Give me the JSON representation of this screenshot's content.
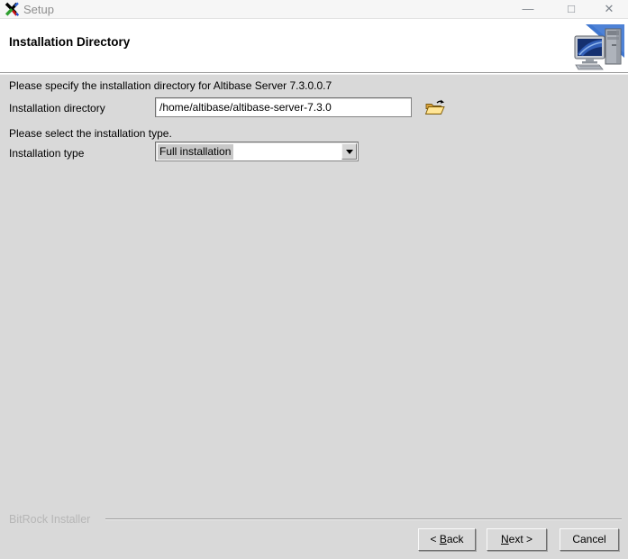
{
  "titlebar": {
    "title": "Setup",
    "minimize_glyph": "—",
    "maximize_glyph": "□",
    "close_glyph": "✕"
  },
  "header": {
    "title": "Installation Directory"
  },
  "form": {
    "directory_prompt": "Please specify the installation directory for Altibase Server 7.3.0.0.7",
    "directory_label": "Installation directory",
    "directory_value": "/home/altibase/altibase-server-7.3.0",
    "type_prompt": "Please select the installation type.",
    "type_label": "Installation type",
    "type_selected": "Full installation"
  },
  "footer": {
    "brand": "BitRock Installer",
    "buttons": {
      "back": {
        "prefix": "< ",
        "accesskey": "B",
        "suffix": "ack"
      },
      "next": {
        "prefix": "",
        "accesskey": "N",
        "suffix": "ext >"
      },
      "cancel": {
        "label": "Cancel"
      }
    }
  },
  "colors": {
    "content_bg": "#d9d9d9",
    "titlebar_bg": "#f6f6f6",
    "selection_bg": "#c8c8c8",
    "accent_blue": "#3f76cf",
    "folder_yellow": "#f5c84c"
  }
}
